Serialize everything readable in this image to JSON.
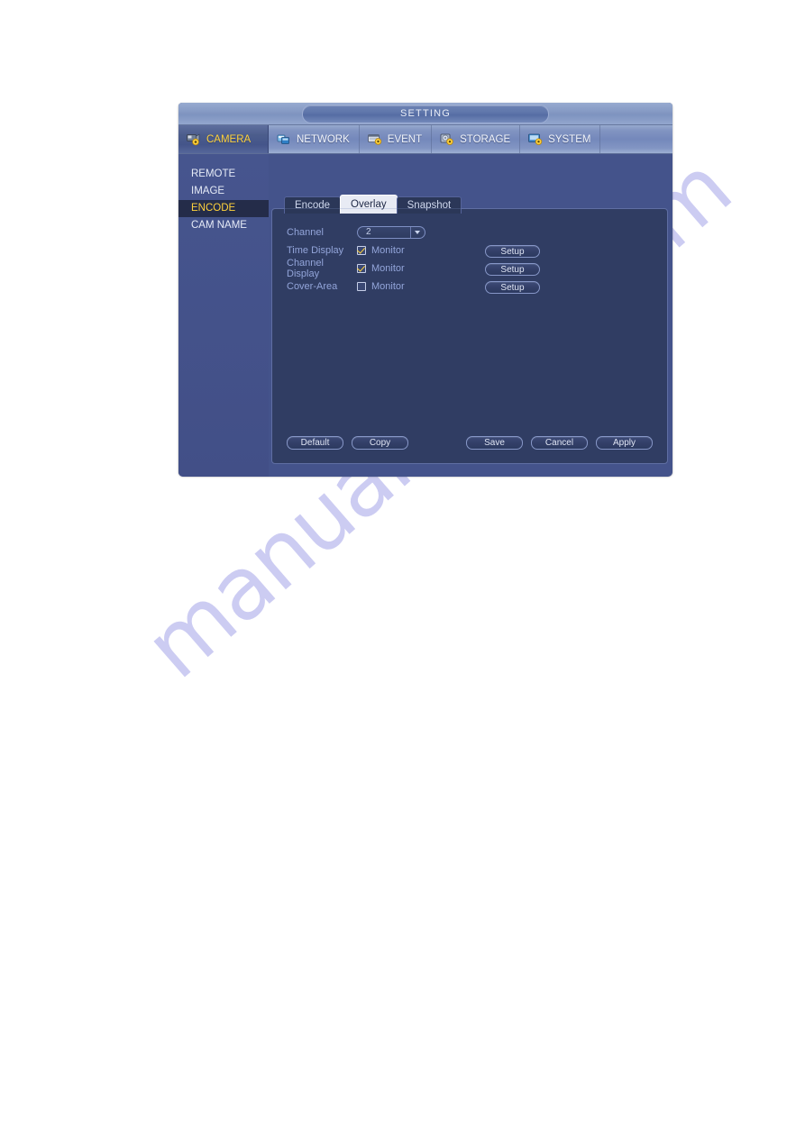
{
  "window": {
    "title": "SETTING"
  },
  "menubar": {
    "items": [
      {
        "label": "CAMERA",
        "icon": "camera-gear-icon",
        "active": true
      },
      {
        "label": "NETWORK",
        "icon": "network-icon",
        "active": false
      },
      {
        "label": "EVENT",
        "icon": "event-gear-icon",
        "active": false
      },
      {
        "label": "STORAGE",
        "icon": "storage-gear-icon",
        "active": false
      },
      {
        "label": "SYSTEM",
        "icon": "system-gear-icon",
        "active": false
      }
    ]
  },
  "sidebar": {
    "items": [
      {
        "label": "REMOTE",
        "active": false
      },
      {
        "label": "IMAGE",
        "active": false
      },
      {
        "label": "ENCODE",
        "active": true
      },
      {
        "label": "CAM NAME",
        "active": false
      }
    ]
  },
  "panel": {
    "tabs": [
      {
        "label": "Encode",
        "active": false
      },
      {
        "label": "Overlay",
        "active": true
      },
      {
        "label": "Snapshot",
        "active": false
      }
    ],
    "rows": [
      {
        "label": "Channel",
        "control": "select",
        "value": "2",
        "arrow_icon": "chevron-down-icon"
      },
      {
        "label": "Time Display",
        "control": "checkbox",
        "checked": true,
        "checkbox_label": "Monitor",
        "button": "Setup"
      },
      {
        "label": "Channel Display",
        "control": "checkbox",
        "checked": true,
        "checkbox_label": "Monitor",
        "button": "Setup"
      },
      {
        "label": "Cover-Area",
        "control": "checkbox",
        "checked": false,
        "checkbox_label": "Monitor",
        "button": "Setup"
      }
    ],
    "actions": {
      "left": [
        "Default",
        "Copy"
      ],
      "right": [
        "Save",
        "Cancel",
        "Apply"
      ]
    }
  },
  "watermark": {
    "text": "manualshive.com"
  },
  "colors": {
    "accent_yellow": "#ffd23c",
    "label_blue": "#93a5da",
    "panel_bg": "#303d63",
    "sidebar_bg": "#44538b",
    "watermark": "#ccccf2"
  }
}
